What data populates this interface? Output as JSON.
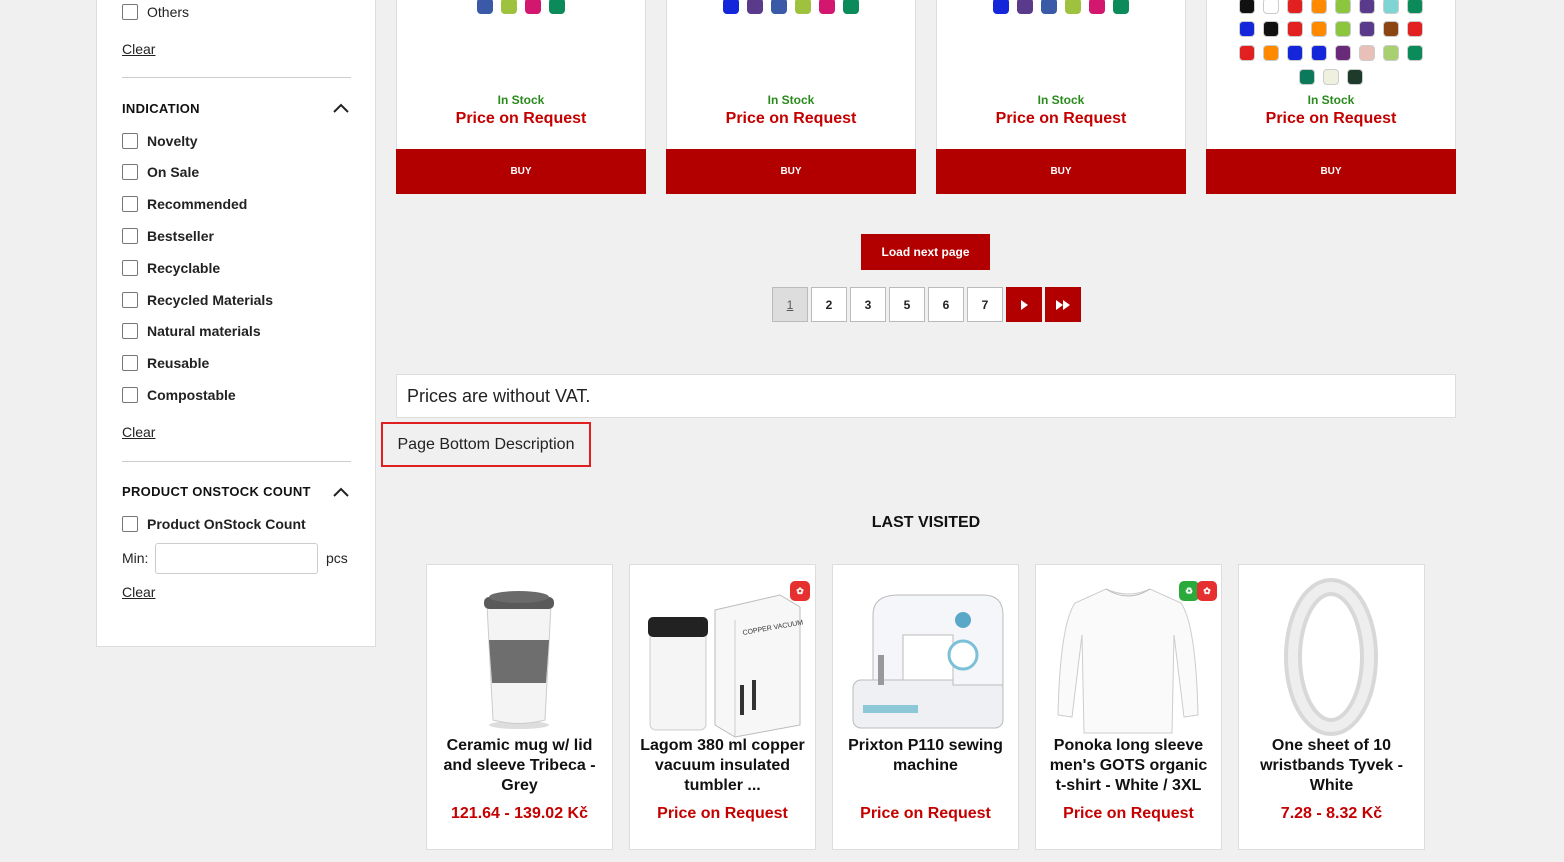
{
  "sidebar": {
    "others_label": "Others",
    "clear_label": "Clear",
    "indication": {
      "title": "INDICATION",
      "items": [
        "Novelty",
        "On Sale",
        "Recommended",
        "Bestseller",
        "Recyclable",
        "Recycled Materials",
        "Natural materials",
        "Reusable",
        "Compostable"
      ]
    },
    "onstock": {
      "title": "PRODUCT ONSTOCK COUNT",
      "checkbox_label": "Product OnStock Count",
      "min_label": "Min:",
      "unit_label": "pcs"
    }
  },
  "products": [
    {
      "stock": "In Stock",
      "price": "Price on Request",
      "buy": "BUY",
      "colors": [
        "#3a5aa8",
        "#9ec13e",
        "#d4176e",
        "#0b8a5a"
      ]
    },
    {
      "stock": "In Stock",
      "price": "Price on Request",
      "buy": "BUY",
      "colors": [
        "#1326d9",
        "#5a3a8a",
        "#3a5aa8",
        "#9ec13e",
        "#d4176e",
        "#0b8a5a"
      ]
    },
    {
      "stock": "In Stock",
      "price": "Price on Request",
      "buy": "BUY",
      "colors": [
        "#1326d9",
        "#5a3a8a",
        "#3a5aa8",
        "#9ec13e",
        "#d4176e",
        "#0b8a5a"
      ]
    },
    {
      "stock": "In Stock",
      "price": "Price on Request",
      "buy": "BUY",
      "colors": [
        "#111111",
        "#ffffff",
        "#e32020",
        "#ff8a00",
        "#8cc63f",
        "#5a3a8a",
        "#7fd4d4",
        "#0b8a5a",
        "#1326d9",
        "#111111",
        "#e32020",
        "#ff8a00",
        "#8cc63f",
        "#5a3a8a",
        "#8b4513",
        "#e32020",
        "#e32020",
        "#ff8a00",
        "#1326d9",
        "#1326d9",
        "#6a2a7a",
        "#e8c0b8",
        "#a8d070",
        "#0b8a5a",
        "#0b7a5a",
        "#f0f0e0",
        "#1e3a2a"
      ]
    }
  ],
  "pagination": {
    "load_next": "Load next page",
    "pages": [
      "1",
      "2",
      "3",
      "5",
      "6",
      "7"
    ],
    "next_icon": "next-arrow-icon",
    "last_icon": "last-arrow-icon"
  },
  "vat_note": "Prices are without VAT.",
  "bottom_description": "Page Bottom Description",
  "last_visited": {
    "title": "LAST VISITED",
    "items": [
      {
        "name": "Ceramic mug w/ lid and sleeve Tribeca - Grey",
        "price": "121.64 - 139.02 Kč",
        "image": "mug-icon"
      },
      {
        "name": "Lagom 380 ml copper vacuum insulated tumbler ...",
        "price": "Price on Request",
        "image": "tumbler-icon",
        "box_text": "COPPER VACUUM INSULATION"
      },
      {
        "name": "Prixton P110 sewing machine",
        "price": "Price on Request",
        "image": "sewing-machine-icon"
      },
      {
        "name": "Ponoka long sleeve men's GOTS organic t-shirt - White / 3XL",
        "price": "Price on Request",
        "image": "tshirt-icon"
      },
      {
        "name": "One sheet of 10 wristbands Tyvek - White",
        "price": "7.28 - 8.32 Kč",
        "image": "wristband-icon"
      }
    ]
  },
  "colors": {
    "brand_red": "#b20000",
    "stock_green": "#2b8a1d",
    "price_red": "#c40000"
  }
}
